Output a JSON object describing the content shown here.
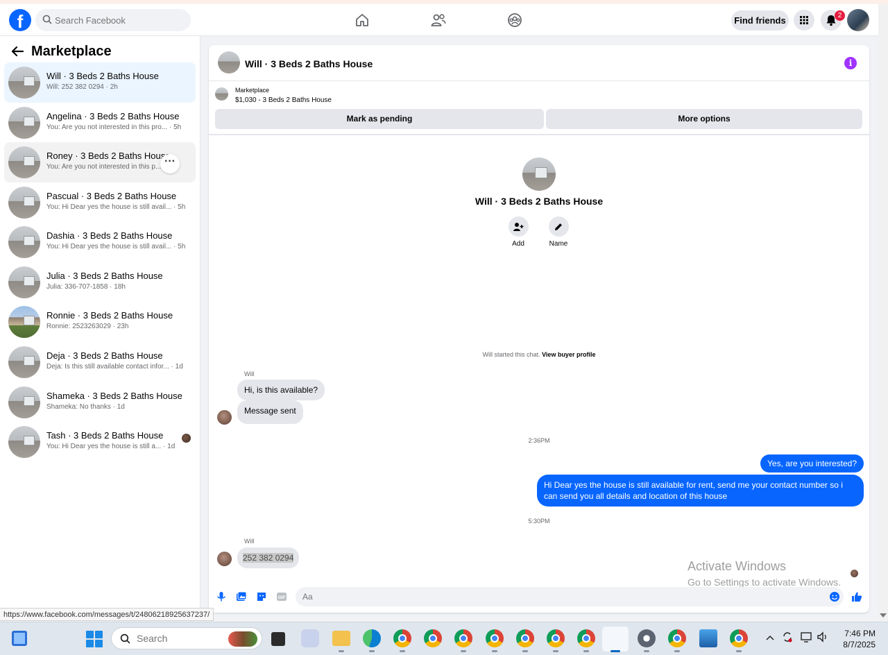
{
  "header": {
    "search_placeholder": "Search Facebook",
    "find_friends": "Find friends",
    "notification_count": "2"
  },
  "sidebar": {
    "title": "Marketplace",
    "conversations": [
      {
        "name": "Will · 3 Beds 2 Baths House",
        "preview": "Will: 252 382 0294 · 2h"
      },
      {
        "name": "Angelina · 3 Beds 2 Baths House",
        "preview": "You: Are you not interested in this pro... · 5h"
      },
      {
        "name": "Roney · 3 Beds 2 Baths House",
        "preview": "You: Are you not interested in this p... · 5h"
      },
      {
        "name": "Pascual · 3 Beds 2 Baths House",
        "preview": "You: Hi Dear yes the house is still avail... · 5h"
      },
      {
        "name": "Dashia · 3 Beds 2 Baths House",
        "preview": "You: Hi Dear yes the house is still avail... · 5h"
      },
      {
        "name": "Julia · 3 Beds 2 Baths House",
        "preview": "Julia: 336-707-1858 · 18h"
      },
      {
        "name": "Ronnie · 3 Beds 2 Baths House",
        "preview": "Ronnie: 2523263029 · 23h"
      },
      {
        "name": "Deja · 3 Beds 2 Baths House",
        "preview": "Deja: Is this still available contact infor... · 1d"
      },
      {
        "name": "Shameka · 3 Beds 2 Baths House",
        "preview": "Shameka: No thanks · 1d"
      },
      {
        "name": "Tash · 3 Beds 2 Baths House",
        "preview": "You: Hi Dear yes the house is still a... · 1d"
      }
    ]
  },
  "chat": {
    "title": "Will · 3 Beds 2 Baths House",
    "listing_source": "Marketplace",
    "listing_price": "$1,030 - 3 Beds 2 Baths House",
    "mark_pending": "Mark as pending",
    "more_options": "More options",
    "profile_name": "Will · 3 Beds 2 Baths House",
    "add_label": "Add",
    "name_label": "Name",
    "started_text": "Will started this chat.",
    "view_profile": "View buyer profile",
    "sender_name": "Will",
    "messages": {
      "in1": "Hi, is this available?",
      "in2": "Message sent",
      "time1": "2:36PM",
      "out1": "Yes, are you interested?",
      "out2": "Hi Dear yes the house is still available for rent, send me your contact number so i can send you all details and location of this house",
      "time2": "5:30PM",
      "in3": "252 382 0294"
    },
    "composer_placeholder": "Aa"
  },
  "watermark": {
    "line1": "Activate Windows",
    "line2": "Go to Settings to activate Windows."
  },
  "status_url": "https://www.facebook.com/messages/t/24806218925637237/",
  "taskbar": {
    "search_placeholder": "Search",
    "time": "7:46 PM",
    "date": "8/7/2025"
  }
}
